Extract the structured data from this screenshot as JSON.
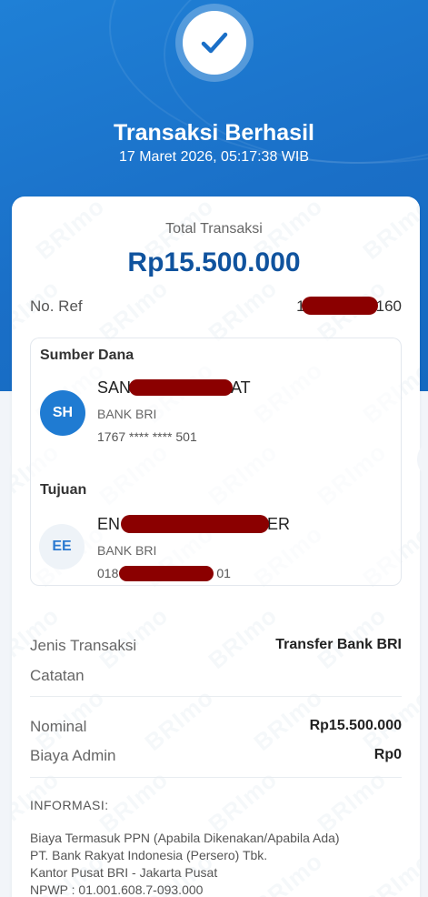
{
  "header": {
    "title": "Transaksi Berhasil",
    "datetime": "17 Maret 2026, 05:17:38 WIB",
    "status_icon": "check-icon"
  },
  "summary": {
    "total_label": "Total Transaksi",
    "total_amount": "Rp15.500.000",
    "ref_label": "No. Ref",
    "ref_value_prefix": "1",
    "ref_value_suffix": "160"
  },
  "source": {
    "heading": "Sumber Dana",
    "initials": "SH",
    "name_prefix": "SAN",
    "name_suffix": "AT",
    "bank": "BANK BRI",
    "account": "1767 **** **** 501"
  },
  "destination": {
    "heading": "Tujuan",
    "initials": "EE",
    "name_prefix": "EN",
    "name_suffix": "ER",
    "bank": "BANK BRI",
    "account_prefix": "018",
    "account_suffix": "01"
  },
  "details": {
    "type_label": "Jenis Transaksi",
    "type_value": "Transfer Bank BRI",
    "note_label": "Catatan",
    "nominal_label": "Nominal",
    "nominal_value": "Rp15.500.000",
    "fee_label": "Biaya Admin",
    "fee_value": "Rp0"
  },
  "info": {
    "heading": "INFORMASI:",
    "lines": [
      "Biaya Termasuk PPN (Apabila Dikenakan/Apabila Ada)",
      "PT. Bank Rakyat Indonesia (Persero) Tbk.",
      "Kantor Pusat BRI - Jakarta Pusat",
      "NPWP : 01.001.608.7-093.000"
    ]
  },
  "colors": {
    "brand_blue": "#1a6fc7",
    "amount_blue": "#10539e",
    "redaction": "#8b0000"
  }
}
